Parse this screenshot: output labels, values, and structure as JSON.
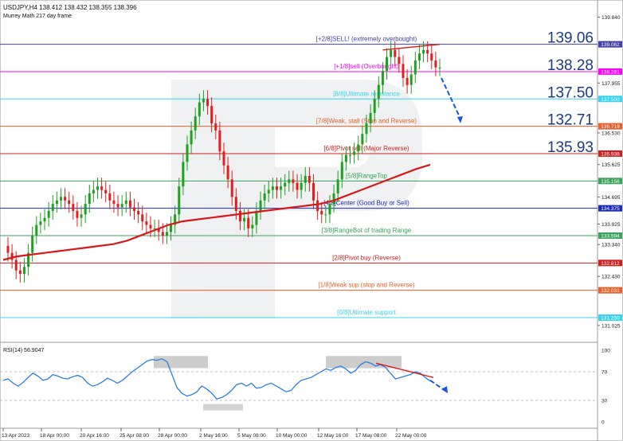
{
  "header": {
    "symbol_line": "USDJPY,H4  138.412 138.432 138.355 138.396",
    "indicator_line": "Murrey Math 217 day frame"
  },
  "big_labels": [
    "139.06",
    "138.28",
    "137.50",
    "132.71",
    "135.93"
  ],
  "murrey_levels": [
    {
      "label": "[+2/8]SELL! (extremely overbought)",
      "price": 139.062,
      "tag": "139.062",
      "color": "#3f3fa6"
    },
    {
      "label": "[+1/8]sell (Overbought)",
      "price": 138.281,
      "tag": "138.281",
      "color": "#ff00ff"
    },
    {
      "label": "[8/8]Ultimate resistance",
      "price": 137.5,
      "tag": "137.500",
      "color": "#36d4f0"
    },
    {
      "label": "[7/8]Weak, stall (Stop and Reverse)",
      "price": 136.719,
      "tag": "136.719",
      "color": "#e8602a"
    },
    {
      "label": "[6/8]Pivot sell (Major Reverse)",
      "price": 135.938,
      "tag": "135.938",
      "color": "#d21e1e"
    },
    {
      "label": "[5/8]RangeTop",
      "price": 135.156,
      "tag": "135.156",
      "color": "#3aa35b"
    },
    {
      "label": "[4/8]Center (Good Buy or Sell)",
      "price": 134.375,
      "tag": "134.375",
      "color": "#1c2ab8"
    },
    {
      "label": "[3/8]RangeBot of trading Range",
      "price": 133.594,
      "tag": "133.594",
      "color": "#3aa35b"
    },
    {
      "label": "[2/8]Pivot buy (Reverse)",
      "price": 132.812,
      "tag": "132.812",
      "color": "#d21e1e"
    },
    {
      "label": "[1/8]Weak sup (stop and Reverse)",
      "price": 132.031,
      "tag": "132.031",
      "color": "#e8602a"
    },
    {
      "label": "[0/8]Ultimate support",
      "price": 131.25,
      "tag": "131.250",
      "color": "#36d4f0"
    }
  ],
  "price_axis_ticks": [
    "139.840",
    "137.955",
    "136.530",
    "135.625",
    "134.695",
    "133.925",
    "133.340",
    "132.430",
    "131.025"
  ],
  "rsi": {
    "label": "RSI(14) 56.9047",
    "ticks": [
      "100",
      "70",
      "30",
      "0"
    ]
  },
  "time_axis": [
    "13 Apr 2023",
    "18 Apr 00:00",
    "20 Apr 16:00",
    "25 Apr 08:00",
    "28 Apr 00:00",
    "2 May 16:00",
    "5 May 08:00",
    "10 May 00:00",
    "12 May 16:00",
    "17 May 08:00",
    "22 May 00:00"
  ],
  "chart_data": {
    "type": "line",
    "title": "USDJPY,H4",
    "y_range": [
      131.0,
      140.1
    ],
    "price_series": {
      "name": "USDJPY H4 close",
      "values": [
        133.1,
        132.9,
        132.6,
        132.5,
        132.7,
        133.1,
        133.6,
        133.9,
        134.0,
        134.1,
        134.3,
        134.5,
        134.6,
        134.7,
        134.6,
        134.5,
        134.3,
        134.1,
        134.2,
        134.5,
        134.8,
        134.9,
        135.0,
        134.9,
        134.8,
        134.6,
        134.5,
        134.4,
        134.5,
        134.6,
        134.4,
        134.3,
        134.2,
        134.0,
        133.9,
        133.8,
        133.8,
        133.7,
        133.6,
        133.7,
        133.9,
        134.2,
        135.0,
        135.7,
        136.2,
        136.6,
        137.0,
        137.4,
        137.5,
        137.3,
        136.8,
        136.6,
        136.0,
        135.6,
        135.2,
        134.7,
        134.3,
        134.0,
        134.1,
        133.8,
        133.9,
        134.3,
        134.6,
        134.8,
        134.9,
        135.0,
        134.9,
        135.0,
        135.1,
        135.2,
        135.1,
        134.9,
        135.1,
        135.3,
        135.1,
        134.6,
        134.3,
        134.2,
        134.2,
        134.5,
        134.8,
        135.2,
        135.7,
        135.9,
        135.9,
        136.0,
        136.2,
        136.5,
        136.8,
        137.1,
        137.5,
        137.9,
        138.3,
        138.7,
        138.9,
        138.7,
        138.5,
        138.1,
        137.9,
        138.2,
        138.6,
        138.8,
        138.9,
        138.8,
        138.6,
        138.4,
        138.4
      ]
    },
    "moving_average": {
      "values": [
        132.9,
        133.0,
        133.05,
        133.1,
        133.15,
        133.2,
        133.25,
        133.3,
        133.35,
        133.45,
        133.6,
        133.75,
        133.9,
        134.0,
        134.05,
        134.1,
        134.15,
        134.2,
        134.25,
        134.3,
        134.35,
        134.4,
        134.45,
        134.5,
        134.6,
        134.75,
        134.9,
        135.05,
        135.2,
        135.35,
        135.5,
        135.62
      ]
    },
    "rsi_series": {
      "name": "RSI(14)",
      "values": [
        58,
        60,
        54,
        50,
        55,
        62,
        68,
        64,
        58,
        60,
        66,
        64,
        61,
        60,
        63,
        65,
        62,
        54,
        50,
        52,
        56,
        61,
        58,
        54,
        58,
        64,
        70,
        75,
        80,
        85,
        87,
        86,
        88,
        84,
        66,
        48,
        40,
        36,
        38,
        42,
        50,
        46,
        40,
        32,
        34,
        38,
        44,
        52,
        54,
        50,
        54,
        47,
        48,
        52,
        54,
        50,
        46,
        42,
        44,
        52,
        58,
        60,
        62,
        66,
        70,
        74,
        72,
        76,
        78,
        74,
        68,
        72,
        80,
        84,
        82,
        78,
        80,
        76,
        68,
        60,
        62,
        64,
        66,
        70,
        68,
        62,
        57
      ]
    },
    "rsi_range": [
      0,
      100
    ],
    "rsi_levels": [
      70,
      30
    ],
    "trendline_price": {
      "start": 138.9,
      "end": 139.06
    },
    "trendline_rsi": {
      "start": 82,
      "end": 62
    },
    "forecast_arrow_price": {
      "from": 138.1,
      "to": 136.8
    },
    "forecast_arrow_rsi": {
      "from": 58,
      "to": 40
    }
  }
}
